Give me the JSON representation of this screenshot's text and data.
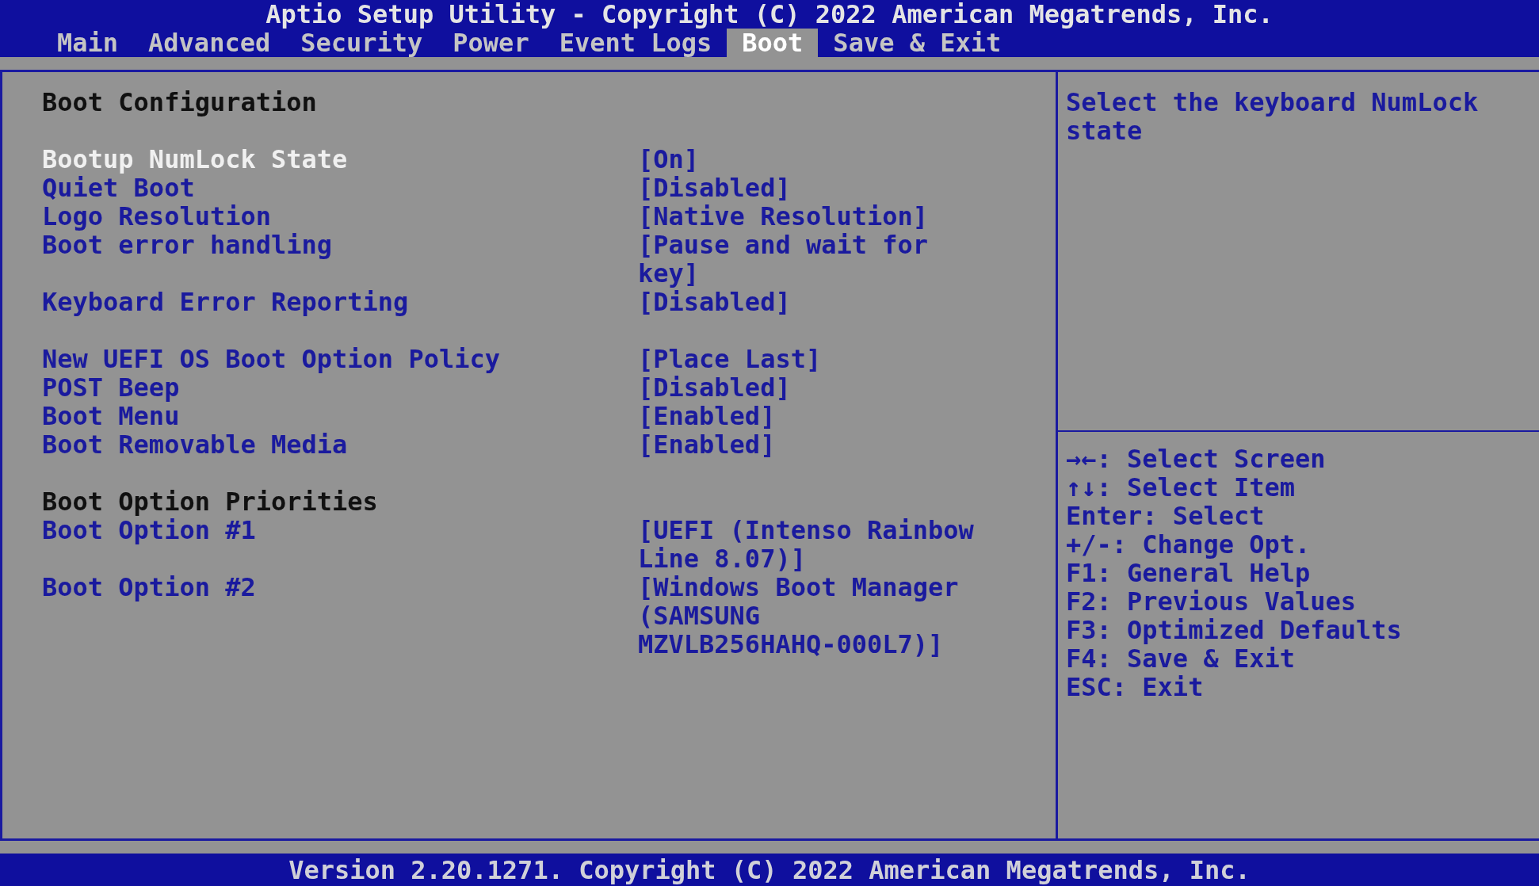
{
  "window": {
    "title": "Aptio Setup Utility - Copyright (C) 2022 American Megatrends, Inc."
  },
  "tabs": [
    {
      "label": "Main",
      "selected": false
    },
    {
      "label": "Advanced",
      "selected": false
    },
    {
      "label": "Security",
      "selected": false
    },
    {
      "label": "Power",
      "selected": false
    },
    {
      "label": "Event Logs",
      "selected": false
    },
    {
      "label": "Boot",
      "selected": true
    },
    {
      "label": "Save & Exit",
      "selected": false
    }
  ],
  "groups": [
    {
      "items": [
        {
          "kind": "heading",
          "label": "Boot Configuration"
        }
      ]
    },
    {
      "items": [
        {
          "kind": "setting",
          "label": "Bootup NumLock State",
          "value": "[On]",
          "selected": true
        },
        {
          "kind": "setting",
          "label": "Quiet Boot",
          "value": "[Disabled]",
          "selected": false
        },
        {
          "kind": "setting",
          "label": "Logo Resolution",
          "value": "[Native Resolution]",
          "selected": false
        },
        {
          "kind": "setting",
          "label": "Boot error handling",
          "value": "[Pause and wait for key]",
          "selected": false
        },
        {
          "kind": "setting",
          "label": "Keyboard Error Reporting",
          "value": "[Disabled]",
          "selected": false
        }
      ]
    },
    {
      "items": [
        {
          "kind": "setting",
          "label": "New UEFI OS Boot Option Policy",
          "value": "[Place Last]",
          "selected": false
        },
        {
          "kind": "setting",
          "label": "POST Beep",
          "value": "[Disabled]",
          "selected": false
        },
        {
          "kind": "setting",
          "label": "Boot Menu",
          "value": "[Enabled]",
          "selected": false
        },
        {
          "kind": "setting",
          "label": "Boot Removable Media",
          "value": "[Enabled]",
          "selected": false
        }
      ]
    },
    {
      "items": [
        {
          "kind": "heading",
          "label": "Boot Option Priorities"
        },
        {
          "kind": "setting",
          "label": "Boot Option #1",
          "value": "[UEFI (Intenso Rainbow Line 8.07)]",
          "selected": false
        },
        {
          "kind": "setting",
          "label": "Boot Option #2",
          "value": "[Windows Boot Manager (SAMSUNG MZVLB256HAHQ-000L7)]",
          "selected": false
        }
      ]
    }
  ],
  "help": {
    "text": "Select the keyboard NumLock state"
  },
  "keys": [
    "→←: Select Screen",
    "↑↓: Select Item",
    "Enter: Select",
    "+/-: Change Opt.",
    "F1: General Help",
    "F2: Previous Values",
    "F3: Optimized Defaults",
    "F4: Save & Exit",
    "ESC: Exit"
  ],
  "status_bar": {
    "text": "Version 2.20.1271. Copyright (C) 2022 American Megatrends, Inc."
  }
}
